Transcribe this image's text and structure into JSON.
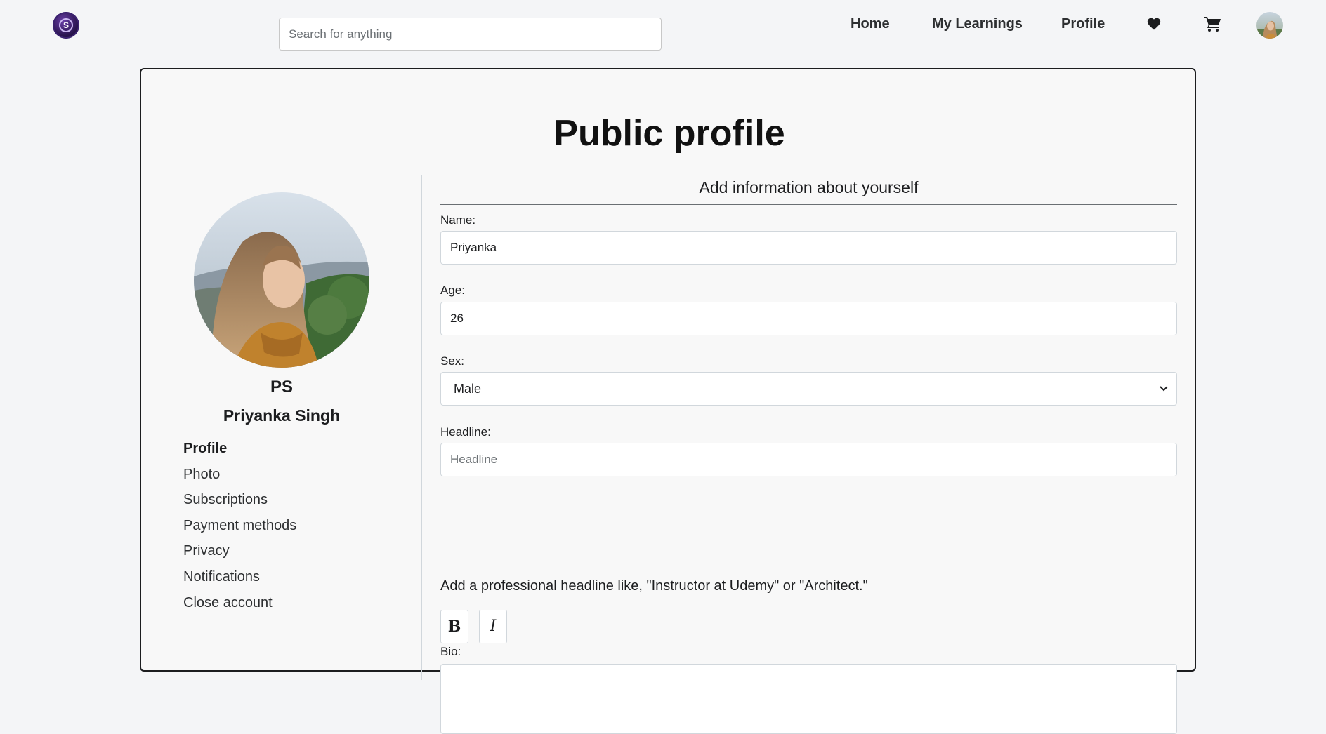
{
  "header": {
    "search_placeholder": "Search for anything",
    "nav": {
      "home": "Home",
      "my_learnings": "My Learnings",
      "profile": "Profile"
    },
    "icons": [
      "heart-icon",
      "cart-icon"
    ]
  },
  "page": {
    "title": "Public profile",
    "subtitle": "Add information about yourself"
  },
  "sidebar": {
    "initials": "PS",
    "full_name": "Priyanka Singh",
    "items": [
      {
        "label": "Profile",
        "active": true
      },
      {
        "label": "Photo",
        "active": false
      },
      {
        "label": "Subscriptions",
        "active": false
      },
      {
        "label": "Payment methods",
        "active": false
      },
      {
        "label": "Privacy",
        "active": false
      },
      {
        "label": "Notifications",
        "active": false
      },
      {
        "label": "Close account",
        "active": false
      }
    ]
  },
  "form": {
    "name_label": "Name:",
    "name_value": "Priyanka",
    "age_label": "Age:",
    "age_value": "26",
    "sex_label": "Sex:",
    "sex_value": "Male",
    "headline_label": "Headline:",
    "headline_placeholder": "Headline",
    "headline_hint": "Add a professional headline like, \"Instructor at Udemy\" or \"Architect.\"",
    "bold_label": "B",
    "italic_label": "I",
    "bio_label": "Bio:"
  }
}
